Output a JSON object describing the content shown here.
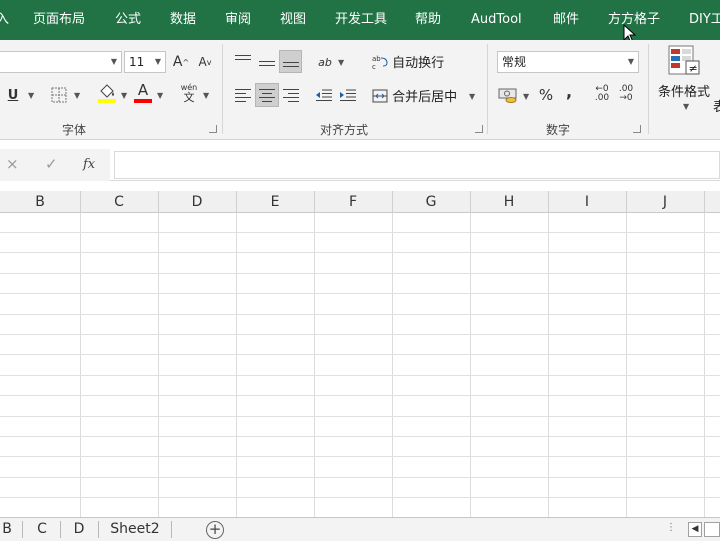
{
  "ribbon_tabs": [
    "入",
    "页面布局",
    "公式",
    "数据",
    "审阅",
    "视图",
    "开发工具",
    "帮助",
    "AudTool",
    "邮件",
    "方方格子",
    "DIY工具箱"
  ],
  "font_group": {
    "font_name": "",
    "font_size": "11",
    "grow_font_glyph": "A",
    "shrink_font_glyph": "A",
    "underline_glyph": "U",
    "font_color_glyph": "A",
    "phonetic_top": "wén",
    "phonetic_bottom": "文",
    "label": "字体",
    "highlight_color": "#ffff00",
    "font_color": "#ff0000"
  },
  "alignment_group": {
    "orientation_glyph": "ab",
    "wrap_text_label": "自动换行",
    "merge_center_label": "合并后居中",
    "label": "对齐方式"
  },
  "number_group": {
    "format_value": "常规",
    "percent_glyph": "%",
    "comma_glyph": ",",
    "increase_decimal_glyph": "←0\n.00",
    "decrease_decimal_glyph": ".00\n→0",
    "label": "数字"
  },
  "styles_group": {
    "conditional_format_label": "条件格式",
    "table_label_partial": "表"
  },
  "formula_bar": {
    "cancel_glyph": "×",
    "enter_glyph": "✓",
    "fx_glyph": "fx",
    "value": ""
  },
  "columns": [
    "B",
    "C",
    "D",
    "E",
    "F",
    "G",
    "H",
    "I",
    "J"
  ],
  "sheet_tabs": [
    "B",
    "C",
    "D",
    "Sheet2"
  ],
  "add_sheet_glyph": "+",
  "scroll_left_glyph": "◀",
  "colors": {
    "brand_green": "#217346",
    "ribbon_bg": "#f3f3f3",
    "selected_button": "#cfcfcf"
  }
}
